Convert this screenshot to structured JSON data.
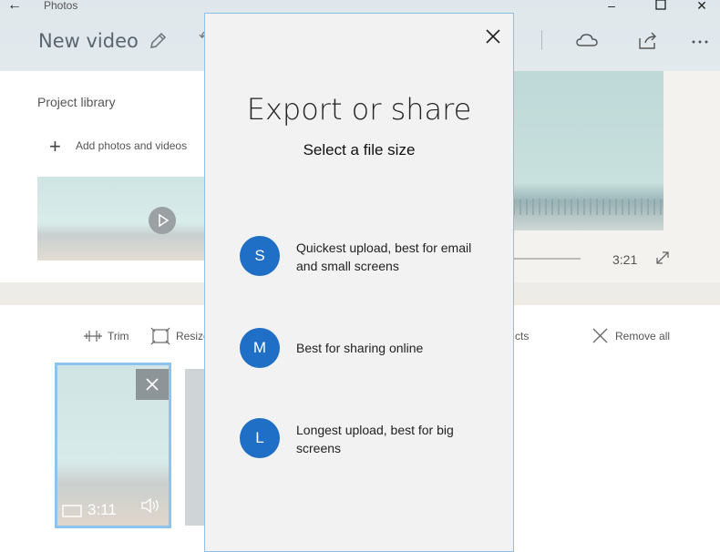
{
  "app": {
    "name": "Photos",
    "back_icon": "back-arrow-icon",
    "window_controls": [
      "minimize-icon",
      "maximize-icon",
      "close-icon"
    ]
  },
  "header": {
    "title": "New video",
    "edit_icon": "pencil-icon",
    "toolbar_icons": [
      "cloud-icon",
      "share-icon",
      "more-icon"
    ]
  },
  "library": {
    "title": "Project library",
    "add_label": "Add photos and videos"
  },
  "preview": {
    "duration": "3:21"
  },
  "storyboard": {
    "trim_label": "Trim",
    "resize_label": "Resize",
    "effects_label": "cts",
    "remove_all_label": "Remove all",
    "clip_time": "3:11"
  },
  "dialog": {
    "title": "Export or share",
    "subtitle": "Select a file size",
    "options": [
      {
        "letter": "S",
        "label": "Quickest upload, best for email and small screens"
      },
      {
        "letter": "M",
        "label": "Best for sharing online"
      },
      {
        "letter": "L",
        "label": "Longest upload, best for big screens"
      }
    ]
  },
  "colors": {
    "accent": "#1f6fc6",
    "dialog_border": "#8cc0e8",
    "selection": "#8cc4ef"
  }
}
